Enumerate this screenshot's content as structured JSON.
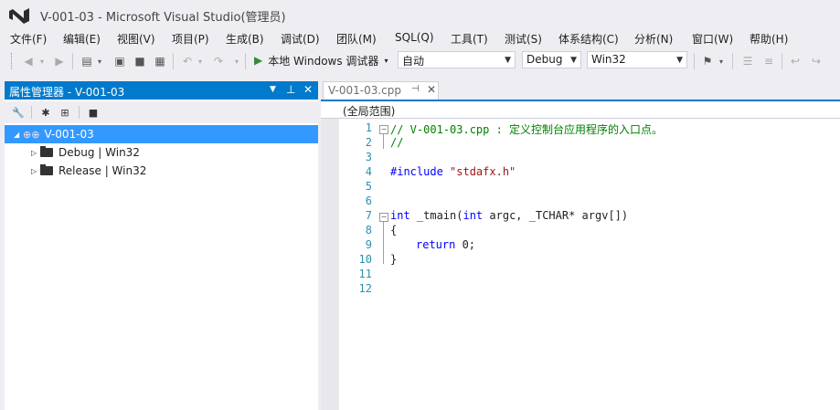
{
  "window": {
    "title": "V-001-03 - Microsoft Visual Studio(管理员)"
  },
  "menu": [
    "文件(F)",
    "编辑(E)",
    "视图(V)",
    "项目(P)",
    "生成(B)",
    "调试(D)",
    "团队(M)",
    "SQL(Q)",
    "工具(T)",
    "测试(S)",
    "体系结构(C)",
    "分析(N)",
    "窗口(W)",
    "帮助(H)"
  ],
  "toolbar": {
    "run_label": "本地 Windows 调试器",
    "run_mode": "自动",
    "configuration": "Debug",
    "platform": "Win32"
  },
  "property_manager": {
    "title": "属性管理器 - V-001-03",
    "project": "V-001-03",
    "configs": [
      "Debug | Win32",
      "Release | Win32"
    ]
  },
  "editor": {
    "tab": "V-001-03.cpp",
    "scope": "(全局范围)",
    "line_numbers": [
      "1",
      "2",
      "3",
      "4",
      "5",
      "6",
      "7",
      "8",
      "9",
      "10",
      "11",
      "12"
    ],
    "lines": {
      "l1": "// V-001-03.cpp : 定义控制台应用程序的入口点。",
      "l2": "//",
      "l4_directive": "#include",
      "l4_file": "\"stdafx.h\"",
      "l7_int": "int",
      "l7_a": " _tmain(",
      "l7_int2": "int",
      "l7_b": " argc, _TCHAR* argv[])",
      "l8": "{",
      "l9_return": "return",
      "l9_rest": " 0;",
      "l10": "}"
    }
  }
}
